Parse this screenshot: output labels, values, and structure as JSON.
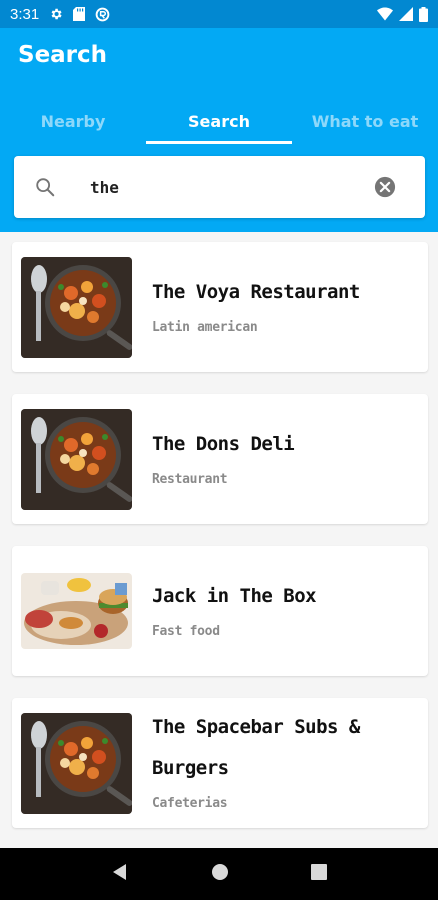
{
  "status_bar": {
    "time": "3:31"
  },
  "app_bar": {
    "title": "Search",
    "tabs": [
      {
        "label": "Nearby",
        "active": false
      },
      {
        "label": "Search",
        "active": true
      },
      {
        "label": "What to eat",
        "active": false
      }
    ]
  },
  "search": {
    "value": "the"
  },
  "results": [
    {
      "name": "The Voya Restaurant",
      "category": "Latin american",
      "image": "dish-skillet"
    },
    {
      "name": "The Dons Deli",
      "category": "Restaurant",
      "image": "dish-skillet"
    },
    {
      "name": "Jack in The Box",
      "category": "Fast food",
      "image": "burger-platter"
    },
    {
      "name": "The Spacebar Subs & Burgers",
      "category": "Cafeterias",
      "image": "dish-skillet"
    }
  ],
  "colors": {
    "status_bar": "#0288d1",
    "app_bar": "#03a9f4",
    "background": "#f5f5f5",
    "nav_bar": "#000000"
  }
}
